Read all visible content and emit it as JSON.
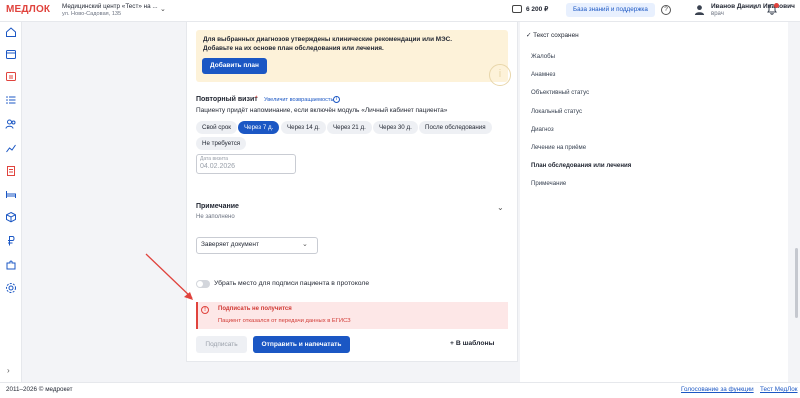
{
  "header": {
    "logo": "МЕДЛОК",
    "clinic_name": "Медицинский центр «Тест» на ...",
    "clinic_address": "ул. Ново-Садовая, 135",
    "balance": "6 200 ₽",
    "knowledge_base_label": "База знаний и поддержка",
    "help_symbol": "?",
    "user_name": "Иванов Даниил Иванович",
    "user_role": "врач",
    "chevron": "⌄"
  },
  "sidebar": {
    "icons": [
      "home-icon",
      "calendar-icon",
      "schedule-icon",
      "tasks-icon",
      "patients-icon",
      "analytics-icon",
      "documents-icon",
      "bed-icon",
      "box-icon",
      "ruble-icon",
      "settings-puzzle-icon",
      "gear-icon"
    ],
    "expand_symbol": "›"
  },
  "banner": {
    "text": "Для выбранных диагнозов утверждены клинические рекомендации или МЭС. Добавьте на их основе план обследования или лечения.",
    "button_label": "Добавить план",
    "watermark_symbol": "i"
  },
  "revisit": {
    "title": "Повторный визит",
    "required_mark": "*",
    "hint_link": "Увеличит возвращаемость",
    "info_symbol": "i",
    "description": "Пациенту придёт напоминание, если включён модуль «Личный кабинет пациента»",
    "options": [
      "Свой срок",
      "Через 7 д.",
      "Через 14 д.",
      "Через 21 д.",
      "Через 30 д.",
      "После обследования",
      "Не требуется"
    ],
    "selected_option": "Через 7 д.",
    "date_label": "Дата визита",
    "date_value": "04.02.2026"
  },
  "note": {
    "title": "Примечание",
    "subtitle": "Не заполнено",
    "chevron": "⌄"
  },
  "certifier": {
    "value": "Заверяет документ",
    "chevron": "⌄"
  },
  "signature_toggle": {
    "label": "Убрать место для подписи пациента в протоколе",
    "enabled": false
  },
  "error": {
    "icon_symbol": "!",
    "title": "Подписать не получится",
    "description": "Пациент отказался от передачи данных в ЕГИСЗ"
  },
  "actions": {
    "sign_label": "Подписать",
    "send_print_label": "Отправить и напечатать",
    "templates_label": "+ В шаблоны"
  },
  "right_rail": {
    "saved_status": "✓ Текст сохранен",
    "items": [
      "Жалобы",
      "Анамнез",
      "Объективный статус",
      "Локальный статус",
      "Диагноз",
      "Лечение на приёме",
      "План обследования или лечения",
      "Примечание"
    ],
    "active_item": "План обследования или лечения"
  },
  "footer": {
    "copyright": "2011–2026 © медрокет",
    "link_functions": "Голосование за функции",
    "link_test": "Тест МедЛок"
  },
  "colors": {
    "accent": "#1b57c4",
    "brand_red": "#e0433d",
    "banner_bg": "#fdf2d9",
    "error_bg": "#fde7e7"
  }
}
